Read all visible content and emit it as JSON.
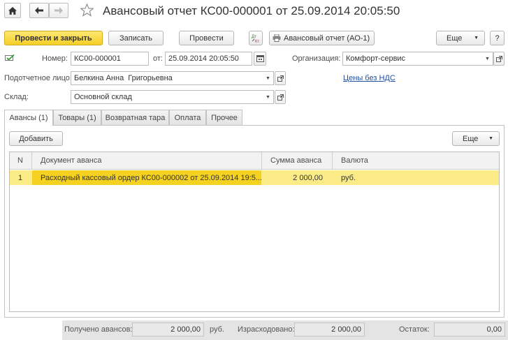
{
  "window": {
    "title": "Авансовый отчет КС00-000001 от 25.09.2014 20:05:50"
  },
  "toolbar": {
    "post_and_close": "Провести и закрыть",
    "save": "Записать",
    "post": "Провести",
    "print_form": "Авансовый отчет (АО-1)",
    "more": "Еще",
    "help": "?"
  },
  "header": {
    "number_label": "Номер:",
    "number_value": "КС00-000001",
    "date_label": "от:",
    "date_value": "25.09.2014 20:05:50",
    "org_label": "Организация:",
    "org_value": "Комфорт-сервис",
    "person_label": "Подотчетное лицо:",
    "person_value": "Белкина Анна  Григорьевна",
    "prices_link": "Цены без НДС",
    "warehouse_label": "Склад:",
    "warehouse_value": "Основной склад"
  },
  "tabs": [
    {
      "label": "Авансы (1)",
      "active": true
    },
    {
      "label": "Товары (1)",
      "active": false
    },
    {
      "label": "Возвратная тара",
      "active": false
    },
    {
      "label": "Оплата",
      "active": false
    },
    {
      "label": "Прочее",
      "active": false
    }
  ],
  "table_toolbar": {
    "add": "Добавить",
    "more": "Еще"
  },
  "table": {
    "columns": [
      "N",
      "Документ аванса",
      "Сумма аванса",
      "Валюта"
    ],
    "rows": [
      [
        "1",
        "Расходный кассовый ордер КС00-000002 от 25.09.2014 19:5...",
        "2 000,00",
        "руб."
      ]
    ]
  },
  "footer": {
    "received_label": "Получено авансов:",
    "received_value": "2 000,00",
    "received_currency": "руб.",
    "spent_label": "Израсходовано:",
    "spent_value": "2 000,00",
    "balance_label": "Остаток:",
    "balance_value": "0,00"
  },
  "colors": {
    "accent": "#f5cf26",
    "selected_row": "#fbec88",
    "selected_cell": "#f5d21f",
    "link": "#1f4fa3"
  },
  "icons": [
    "home-icon",
    "back-arrow-icon",
    "forward-arrow-icon",
    "favorite-star-icon",
    "structure-icon",
    "printer-icon",
    "dropdown-arrow-icon",
    "calendar-icon",
    "open-icon",
    "document-status-icon"
  ]
}
